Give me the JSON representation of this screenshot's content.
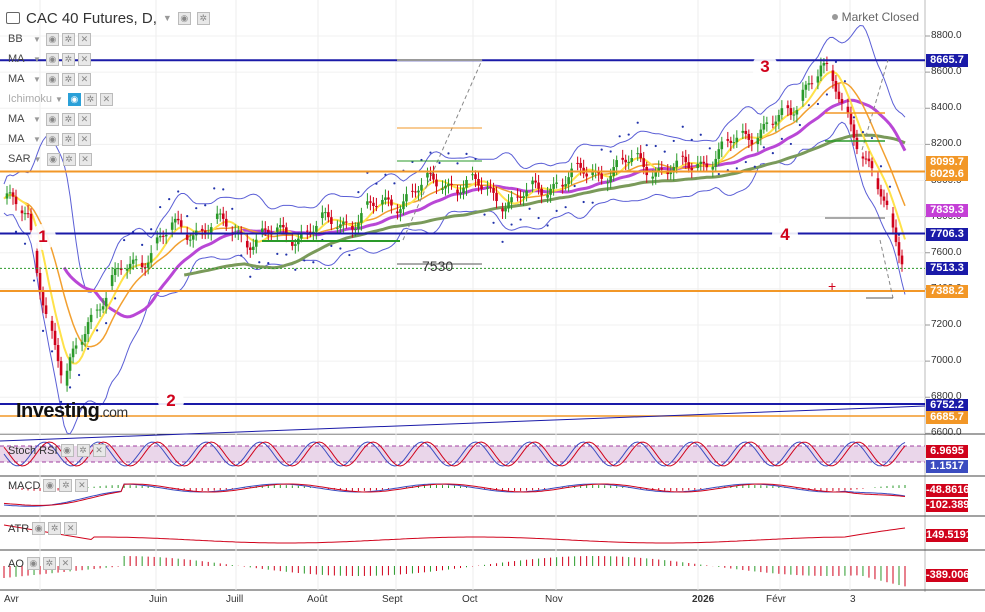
{
  "header": {
    "title": "CAC 40 Futures, D,",
    "market_status": "Market Closed"
  },
  "indicators": [
    {
      "label": "BB",
      "highlighted": false
    },
    {
      "label": "MA",
      "highlighted": false
    },
    {
      "label": "MA",
      "highlighted": false
    },
    {
      "label": "Ichimoku",
      "highlighted": true
    },
    {
      "label": "MA",
      "highlighted": false
    },
    {
      "label": "MA",
      "highlighted": false
    },
    {
      "label": "SAR",
      "highlighted": false
    }
  ],
  "price_axis": {
    "ticks": [
      "8800.0",
      "8600.0",
      "8400.0",
      "8200.0",
      "8000.0",
      "7800.0",
      "7600.0",
      "7400.0",
      "7200.0",
      "7000.0",
      "6800.0",
      "6600.0"
    ]
  },
  "price_tags": [
    {
      "value": "8665.7",
      "color": "#1a1aa8"
    },
    {
      "value": "8099.7",
      "color": "#f29727"
    },
    {
      "value": "8029.6",
      "color": "#f29727"
    },
    {
      "value": "7839.3",
      "color": "#c43fd6"
    },
    {
      "value": "7706.3",
      "color": "#1a1aa8"
    },
    {
      "value": "7513.3",
      "color": "#1a1aa8"
    },
    {
      "value": "7388.2",
      "color": "#f29727"
    },
    {
      "value": "6752.2",
      "color": "#1a1aa8"
    },
    {
      "value": "6685.7",
      "color": "#f29727"
    }
  ],
  "annotations": {
    "wave_labels": [
      "1",
      "2",
      "3",
      "4"
    ],
    "level_text": "7530"
  },
  "x_axis": [
    "Avr",
    "Juin",
    "Juill",
    "Août",
    "Sept",
    "Oct",
    "Nov",
    "2026",
    "Févr",
    "3"
  ],
  "sub_panels": {
    "stoch_rsi": {
      "label": "Stoch RSI",
      "values": [
        "6.9695",
        "1.1517"
      ]
    },
    "macd": {
      "label": "MACD",
      "values": [
        "-48.8616",
        "-102.3896"
      ]
    },
    "atr": {
      "label": "ATR",
      "values": [
        "149.5191"
      ]
    },
    "ao": {
      "label": "AO",
      "values": [
        "-389.0067"
      ]
    }
  },
  "logo": {
    "name": "Investing",
    "suffix": ".com"
  }
}
